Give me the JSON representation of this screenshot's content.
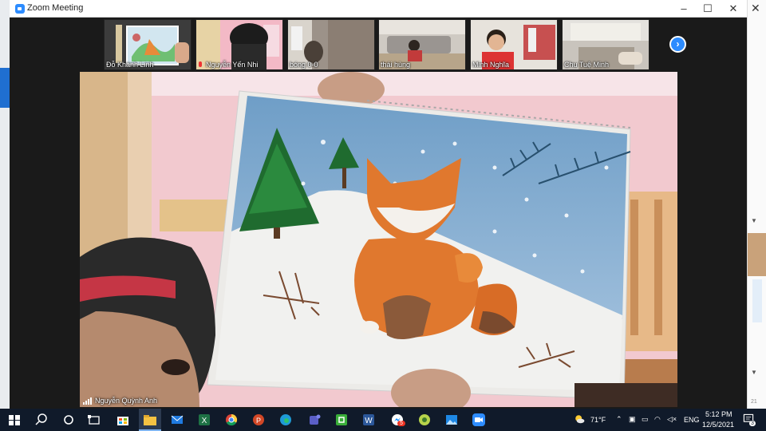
{
  "window": {
    "title": "Zoom Meeting",
    "min": "–",
    "max": "☐",
    "close": "✕"
  },
  "background_app": {
    "close": "✕",
    "side_text": "21"
  },
  "participants": [
    {
      "name": "Đỗ Khánh Linh"
    },
    {
      "name": "Nguyễn Yến Nhi"
    },
    {
      "name": "bóng 0-0"
    },
    {
      "name": "thái hùng"
    },
    {
      "name": "Minh Nghĩa"
    },
    {
      "name": "Chu Tuệ Minh"
    }
  ],
  "next_page": "›",
  "speaker": {
    "name": "Nguyễn Quỳnh Anh"
  },
  "taskbar": {
    "weather": "71°F",
    "language": "ENG",
    "time": "5:12 PM",
    "date": "12/5/2021",
    "notifications": "3",
    "badge": "5"
  },
  "colors": {
    "zoom_blue": "#2d8cff",
    "taskbar": "#101a2a",
    "wall_pink": "#f2c9cf",
    "sky_blue": "#7fa7c9",
    "fox_orange": "#e0782e"
  }
}
